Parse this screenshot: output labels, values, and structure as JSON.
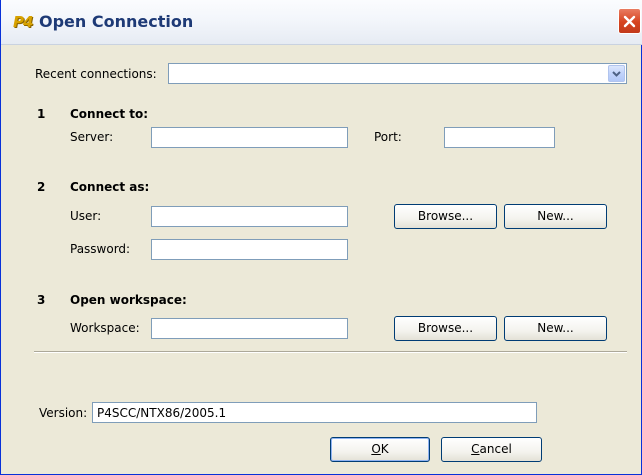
{
  "window": {
    "title": "Open Connection",
    "app_icon_text": "P4"
  },
  "recent": {
    "label": "Recent connections:",
    "value": ""
  },
  "connect_to": {
    "number": "1",
    "title": "Connect to:",
    "server_label": "Server:",
    "server_value": "",
    "port_label": "Port:",
    "port_value": ""
  },
  "connect_as": {
    "number": "2",
    "title": "Connect as:",
    "user_label": "User:",
    "user_value": "",
    "password_label": "Password:",
    "password_value": "",
    "browse_label": "Browse...",
    "new_label": "New..."
  },
  "workspace": {
    "number": "3",
    "title": "Open workspace:",
    "workspace_label": "Workspace:",
    "workspace_value": "",
    "browse_label": "Browse...",
    "new_label": "New..."
  },
  "version": {
    "label": "Version:",
    "value": "P4SCC/NTX86/2005.1"
  },
  "footer": {
    "ok_label_underlined": "O",
    "ok_label_rest": "K",
    "cancel_label_underlined": "C",
    "cancel_label_rest": "ancel"
  },
  "colors": {
    "dialog_bg": "#ECE9D8",
    "title_text": "#1E3A76",
    "close_button": "#D6431F",
    "input_border": "#7F9DB9",
    "button_border": "#003C74"
  },
  "icons": [
    "p4-app-icon",
    "close-icon",
    "chevron-down-icon"
  ]
}
